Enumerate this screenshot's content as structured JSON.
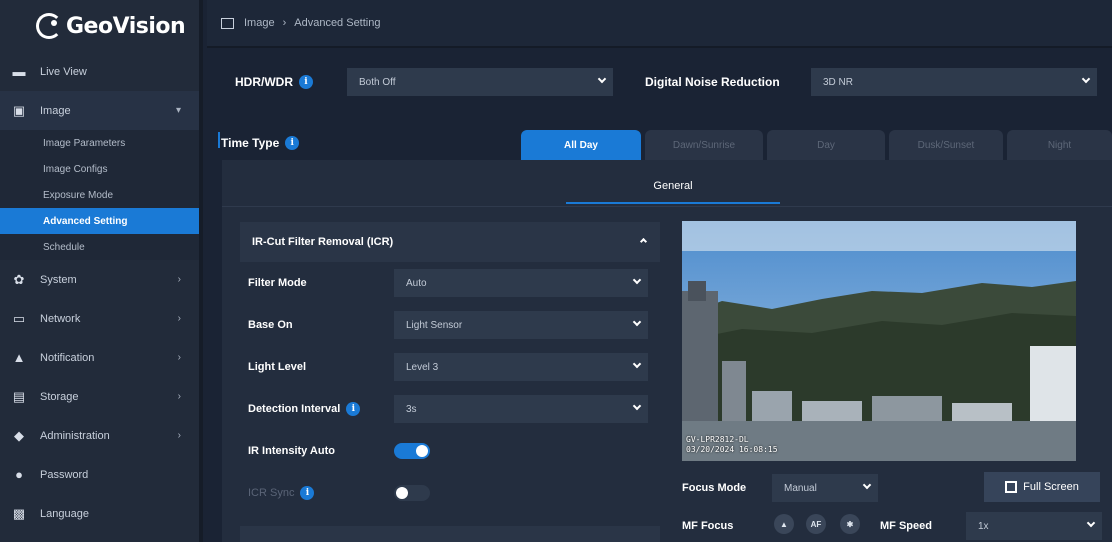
{
  "brand": {
    "name": "GeoVision"
  },
  "sidebar": {
    "items": [
      {
        "label": "Live View",
        "icon": "camera-icon"
      },
      {
        "label": "Image",
        "icon": "image-icon",
        "open": true,
        "children": [
          "Image Parameters",
          "Image Configs",
          "Exposure Mode",
          "Advanced Setting",
          "Schedule"
        ]
      },
      {
        "label": "System",
        "icon": "gear-icon"
      },
      {
        "label": "Network",
        "icon": "monitor-icon"
      },
      {
        "label": "Notification",
        "icon": "bell-icon"
      },
      {
        "label": "Storage",
        "icon": "storage-icon"
      },
      {
        "label": "Administration",
        "icon": "shield-icon"
      },
      {
        "label": "Password",
        "icon": "user-icon"
      },
      {
        "label": "Language",
        "icon": "language-icon"
      }
    ],
    "active_child": "Advanced Setting"
  },
  "breadcrumb": {
    "section": "Image",
    "separator": "›",
    "page": "Advanced Setting"
  },
  "hdr": {
    "label": "HDR/WDR",
    "value": "Both Off"
  },
  "dnr": {
    "label": "Digital Noise Reduction",
    "value": "3D NR"
  },
  "time_type": {
    "label": "Time Type",
    "tabs": [
      "All Day",
      "Dawn/Sunrise",
      "Day",
      "Dusk/Sunset",
      "Night"
    ],
    "active": "All Day"
  },
  "general_tab": "General",
  "icr": {
    "title": "IR-Cut Filter Removal (ICR)",
    "filter_mode": {
      "label": "Filter Mode",
      "value": "Auto"
    },
    "base_on": {
      "label": "Base On",
      "value": "Light Sensor"
    },
    "light_level": {
      "label": "Light Level",
      "value": "Level 3"
    },
    "detection_interval": {
      "label": "Detection Interval",
      "value": "3s"
    },
    "ir_intensity_auto": {
      "label": "IR Intensity Auto",
      "on": true
    },
    "icr_sync": {
      "label": "ICR Sync",
      "on": false
    }
  },
  "preview": {
    "osd_line1": "GV-LPR2812-DL",
    "osd_line2": "03/20/2024 16:08:15"
  },
  "focus": {
    "mode_label": "Focus Mode",
    "mode_value": "Manual",
    "fullscreen_label": "Full Screen",
    "mf_focus_label": "MF Focus",
    "af_label": "AF",
    "mf_speed_label": "MF Speed",
    "mf_speed_value": "1x"
  },
  "colors": {
    "accent": "#1a7ad6",
    "sidebar": "#222b3a",
    "panel": "#232d3e"
  }
}
